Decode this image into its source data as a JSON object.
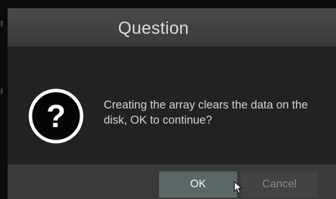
{
  "dialog": {
    "title": "Question",
    "icon": "question-icon",
    "message": "Creating the array clears the data on the\ndisk, OK to continue?"
  },
  "buttons": {
    "ok_label": "OK",
    "cancel_label": "Cancel"
  },
  "colors": {
    "title_bar": "#404040",
    "body": "#222222",
    "footer": "#3a3a3a",
    "ok_button": "#5b6666",
    "cancel_button": "#434343"
  },
  "cursor_icon": "mouse-pointer-icon"
}
